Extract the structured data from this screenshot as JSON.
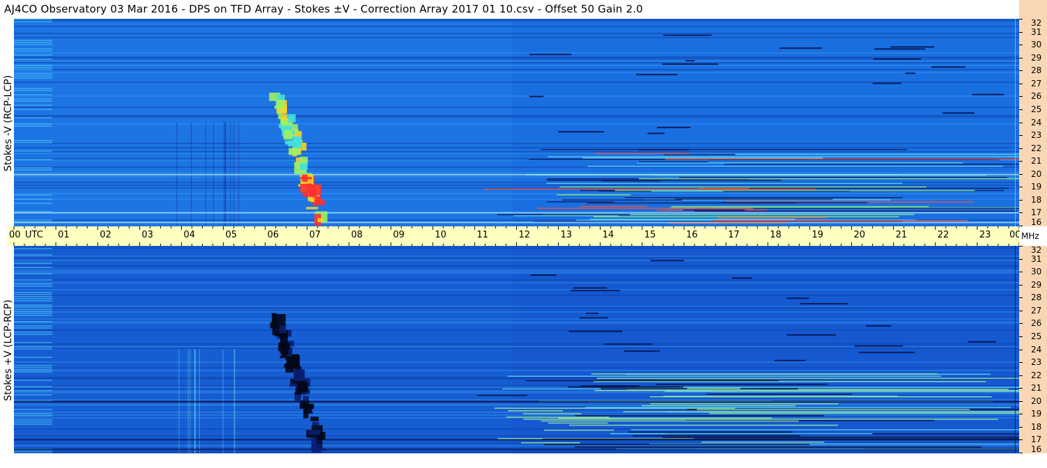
{
  "title": "AJ4CO Observatory  03 Mar 2016  -  DPS on TFD Array  -  Stokes ±V  -  Correction Array 2017 01 10.csv  -  Offset 50  Gain 2.0",
  "panels": [
    {
      "id": "top",
      "ylabel": "Stokes -V (RCP-LCP)"
    },
    {
      "id": "bottom",
      "ylabel": "Stokes +V (LCP-RCP)"
    }
  ],
  "time_axis": {
    "unit_label": "UTC",
    "ticks": [
      "00",
      "01",
      "02",
      "03",
      "04",
      "05",
      "06",
      "07",
      "08",
      "09",
      "10",
      "11",
      "12",
      "13",
      "14",
      "15",
      "16",
      "17",
      "18",
      "19",
      "20",
      "21",
      "22",
      "23",
      "00"
    ]
  },
  "freq_axis": {
    "unit_label": "MHz",
    "ticks": [
      "32",
      "31",
      "30",
      "29",
      "28",
      "27",
      "26",
      "25",
      "24",
      "23",
      "22",
      "21",
      "20",
      "19",
      "18",
      "17",
      "16"
    ]
  },
  "colors": {
    "background_blue": "#1565d8",
    "freq_axis_bg": "#fad7b4",
    "time_axis_bg": "#ffffc0"
  },
  "chart_data": [
    {
      "type": "heatmap",
      "title": "AJ4CO Observatory  03 Mar 2016  -  DPS on TFD Array  -  Stokes ±V  -  Correction Array 2017 01 10.csv  -  Offset 50  Gain 2.0",
      "ylabel": "Stokes -V (RCP-LCP)",
      "xlabel": "UTC",
      "x_range_utc_hours": [
        0,
        24
      ],
      "y_range_mhz": [
        16,
        32
      ],
      "features": [
        {
          "kind": "radio burst (bright, positive)",
          "utc_hours": [
            6.3,
            7.3
          ],
          "mhz": [
            16,
            26
          ]
        },
        {
          "kind": "broadband interference lines",
          "utc_hours": [
            11,
            24
          ],
          "mhz": [
            16,
            22
          ]
        }
      ]
    },
    {
      "type": "heatmap",
      "ylabel": "Stokes +V (LCP-RCP)",
      "xlabel": "UTC",
      "x_range_utc_hours": [
        0,
        24
      ],
      "y_range_mhz": [
        16,
        32
      ],
      "features": [
        {
          "kind": "radio burst (dark, negative)",
          "utc_hours": [
            6.3,
            7.3
          ],
          "mhz": [
            16,
            26
          ]
        },
        {
          "kind": "broadband interference lines",
          "utc_hours": [
            11,
            24
          ],
          "mhz": [
            16,
            22
          ]
        }
      ]
    }
  ]
}
